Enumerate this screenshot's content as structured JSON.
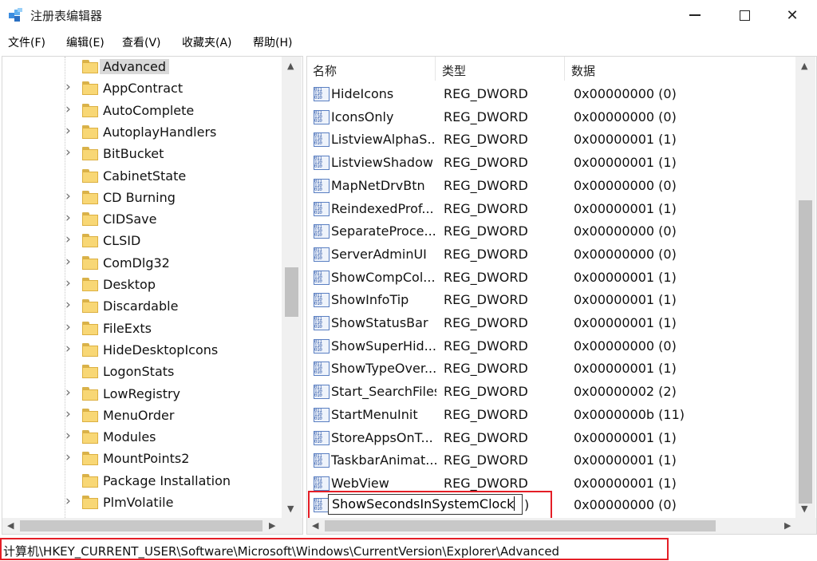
{
  "window": {
    "title": "注册表编辑器"
  },
  "menu": {
    "items": [
      "文件(F)",
      "编辑(E)",
      "查看(V)",
      "收藏夹(A)",
      "帮助(H)"
    ]
  },
  "tree": {
    "items": [
      {
        "label": "Advanced",
        "expandable": false,
        "selected": true
      },
      {
        "label": "AppContract",
        "expandable": true
      },
      {
        "label": "AutoComplete",
        "expandable": true
      },
      {
        "label": "AutoplayHandlers",
        "expandable": true
      },
      {
        "label": "BitBucket",
        "expandable": true
      },
      {
        "label": "CabinetState",
        "expandable": false
      },
      {
        "label": "CD Burning",
        "expandable": true
      },
      {
        "label": "CIDSave",
        "expandable": true
      },
      {
        "label": "CLSID",
        "expandable": true
      },
      {
        "label": "ComDlg32",
        "expandable": true
      },
      {
        "label": "Desktop",
        "expandable": true
      },
      {
        "label": "Discardable",
        "expandable": true
      },
      {
        "label": "FileExts",
        "expandable": true
      },
      {
        "label": "HideDesktopIcons",
        "expandable": true
      },
      {
        "label": "LogonStats",
        "expandable": false
      },
      {
        "label": "LowRegistry",
        "expandable": true
      },
      {
        "label": "MenuOrder",
        "expandable": true
      },
      {
        "label": "Modules",
        "expandable": true
      },
      {
        "label": "MountPoints2",
        "expandable": true
      },
      {
        "label": "Package Installation",
        "expandable": false
      },
      {
        "label": "PlmVolatile",
        "expandable": true
      }
    ]
  },
  "values": {
    "headers": {
      "name": "名称",
      "type": "类型",
      "data": "数据"
    },
    "rows": [
      {
        "name": "HideIcons",
        "type": "REG_DWORD",
        "data": "0x00000000 (0)"
      },
      {
        "name": "IconsOnly",
        "type": "REG_DWORD",
        "data": "0x00000000 (0)"
      },
      {
        "name": "ListviewAlphaS...",
        "type": "REG_DWORD",
        "data": "0x00000001 (1)"
      },
      {
        "name": "ListviewShadow",
        "type": "REG_DWORD",
        "data": "0x00000001 (1)"
      },
      {
        "name": "MapNetDrvBtn",
        "type": "REG_DWORD",
        "data": "0x00000000 (0)"
      },
      {
        "name": "ReindexedProf...",
        "type": "REG_DWORD",
        "data": "0x00000001 (1)"
      },
      {
        "name": "SeparateProce...",
        "type": "REG_DWORD",
        "data": "0x00000000 (0)"
      },
      {
        "name": "ServerAdminUI",
        "type": "REG_DWORD",
        "data": "0x00000000 (0)"
      },
      {
        "name": "ShowCompCol...",
        "type": "REG_DWORD",
        "data": "0x00000001 (1)"
      },
      {
        "name": "ShowInfoTip",
        "type": "REG_DWORD",
        "data": "0x00000001 (1)"
      },
      {
        "name": "ShowStatusBar",
        "type": "REG_DWORD",
        "data": "0x00000001 (1)"
      },
      {
        "name": "ShowSuperHid...",
        "type": "REG_DWORD",
        "data": "0x00000000 (0)"
      },
      {
        "name": "ShowTypeOver...",
        "type": "REG_DWORD",
        "data": "0x00000001 (1)"
      },
      {
        "name": "Start_SearchFiles",
        "type": "REG_DWORD",
        "data": "0x00000002 (2)"
      },
      {
        "name": "StartMenuInit",
        "type": "REG_DWORD",
        "data": "0x0000000b (11)"
      },
      {
        "name": "StoreAppsOnT...",
        "type": "REG_DWORD",
        "data": "0x00000001 (1)"
      },
      {
        "name": "TaskbarAnimat...",
        "type": "REG_DWORD",
        "data": "0x00000001 (1)"
      },
      {
        "name": "WebView",
        "type": "REG_DWORD",
        "data": "0x00000001 (1)"
      }
    ],
    "editing": {
      "value": "ShowSecondsInSystemClock",
      "type_fragment": ")",
      "data": "0x00000000 (0)"
    }
  },
  "status": {
    "path": "计算机\\HKEY_CURRENT_USER\\Software\\Microsoft\\Windows\\CurrentVersion\\Explorer\\Advanced"
  },
  "colors": {
    "highlight": "#e41e26",
    "folder": "#f8d775",
    "selection": "#d9d9d9"
  }
}
